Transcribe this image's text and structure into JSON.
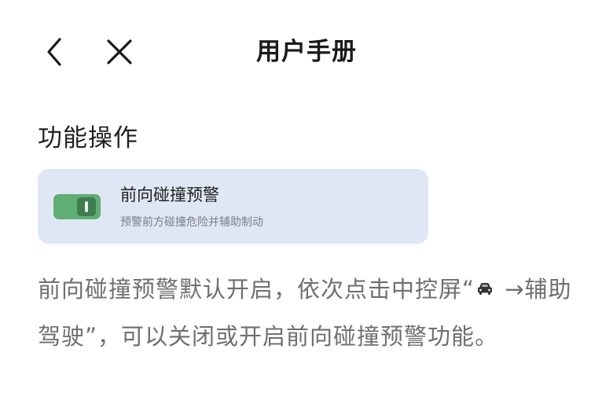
{
  "header": {
    "title": "用户手册",
    "back_icon": "chevron-left-icon",
    "close_icon": "close-icon"
  },
  "section": {
    "title": "功能操作"
  },
  "feature_card": {
    "name": "前向碰撞预警",
    "description": "预警前方碰撞危险并辅助制动",
    "toggle_on": true,
    "toggle_color": "#5fae74",
    "card_color": "#dfe6f4"
  },
  "body": {
    "text_part1": "前向碰撞预警默认开启，依次点击中控屏“",
    "car_icon": "car-icon",
    "text_part2": " →辅助驾驶”，可以关闭或开启前向碰撞预警功能。"
  }
}
